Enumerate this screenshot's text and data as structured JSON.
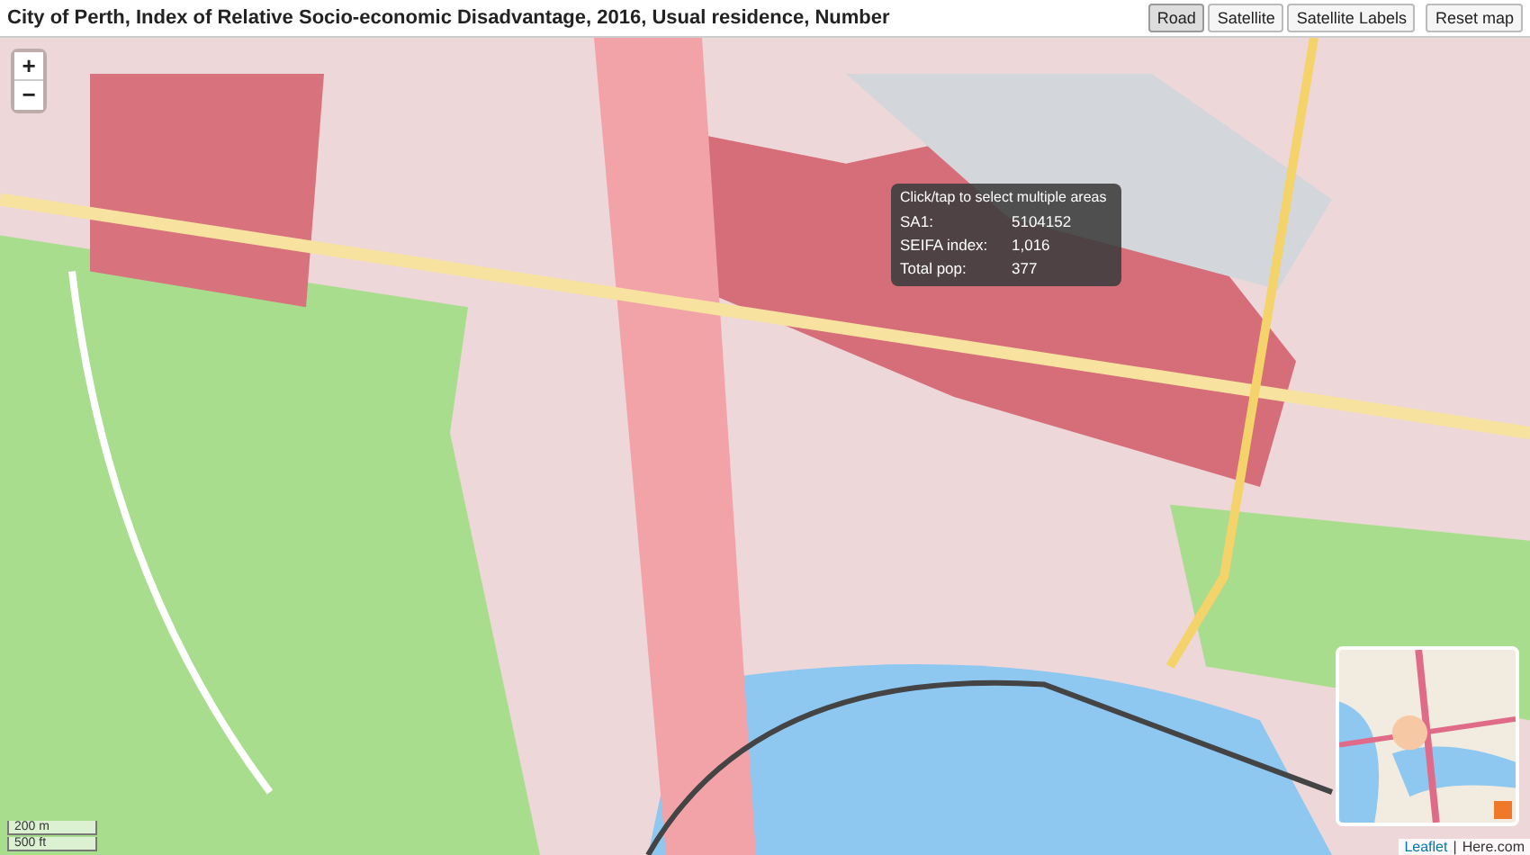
{
  "title": "City of Perth, Index of Relative Socio-economic Disadvantage, 2016, Usual residence, Number",
  "map_types": [
    {
      "label": "Road",
      "selected": true
    },
    {
      "label": "Satellite",
      "selected": false
    },
    {
      "label": "Satellite Labels",
      "selected": false
    }
  ],
  "reset_button": "Reset map",
  "zoom": {
    "in": "+",
    "out": "−"
  },
  "tooltip": {
    "hint": "Click/tap to select multiple areas",
    "rows": [
      {
        "label": "SA1:",
        "value": "5104152"
      },
      {
        "label": "SEIFA index:",
        "value": "1,016"
      },
      {
        "label": "Total pop:",
        "value": "377"
      }
    ]
  },
  "scale": [
    "200 m",
    "500 ft"
  ],
  "attribution": {
    "link": "Leaflet",
    "separator": "|",
    "text": "Here.com"
  }
}
